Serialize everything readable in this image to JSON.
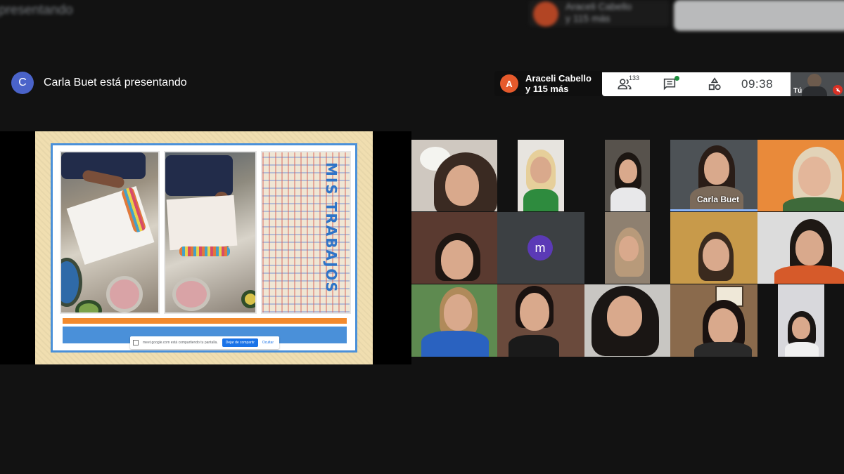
{
  "ghost_header": {
    "title_fragment": "presentando",
    "others_name": "Araceli Cabello",
    "others_more": "y 115 más"
  },
  "presenter": {
    "initial": "C",
    "text": "Carla Buet está presentando"
  },
  "others": {
    "initial": "A",
    "name": "Araceli Cabello",
    "more": "y 115 más"
  },
  "controls": {
    "participants_icon": "people-icon",
    "participant_count": "133",
    "chat_icon": "chat-icon",
    "activities_icon": "shapes-icon",
    "time": "09:38"
  },
  "self_view": {
    "label": "Tú",
    "mic_icon": "mic-off-icon"
  },
  "presentation": {
    "title_on_drawing": "MIS TRABAJOS",
    "share_notice": "meet.google.com está compartiendo tu pantalla.",
    "stop_label": "Dejar de compartir",
    "hide_label": "Ocultar"
  },
  "participants": [
    {
      "name": ""
    },
    {
      "name": ""
    },
    {
      "name": ""
    },
    {
      "name": "Carla Buet"
    },
    {
      "name": ""
    },
    {
      "name": ""
    },
    {
      "name": "",
      "initial": "m"
    },
    {
      "name": ""
    },
    {
      "name": ""
    },
    {
      "name": ""
    },
    {
      "name": ""
    },
    {
      "name": ""
    },
    {
      "name": ""
    },
    {
      "name": ""
    },
    {
      "name": ""
    }
  ],
  "colors": {
    "presenter_avatar": "#4a63c9",
    "others_avatar": "#e65a2c",
    "m_avatar": "#5b3ab6",
    "slide_border": "#4a90d9",
    "orange_bar": "#f28a2e"
  }
}
